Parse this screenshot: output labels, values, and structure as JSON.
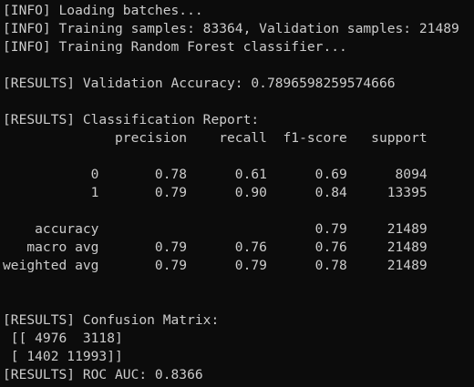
{
  "terminal": {
    "text_color": "#cccccc",
    "background_color": "#0c0c0c",
    "lines": [
      "[INFO] Loading batches...",
      "[INFO] Training samples: 83364, Validation samples: 21489",
      "[INFO] Training Random Forest classifier...",
      "",
      "[RESULTS] Validation Accuracy: 0.7896598259574666",
      "",
      "[RESULTS] Classification Report:",
      "              precision    recall  f1-score   support",
      "",
      "           0       0.78      0.61      0.69      8094",
      "           1       0.79      0.90      0.84     13395",
      "",
      "    accuracy                           0.79     21489",
      "   macro avg       0.79      0.76      0.76     21489",
      "weighted avg       0.79      0.79      0.78     21489",
      "",
      "",
      "[RESULTS] Confusion Matrix:",
      " [[ 4976  3118]",
      " [ 1402 11993]]",
      "[RESULTS] ROC AUC: 0.8366"
    ]
  }
}
